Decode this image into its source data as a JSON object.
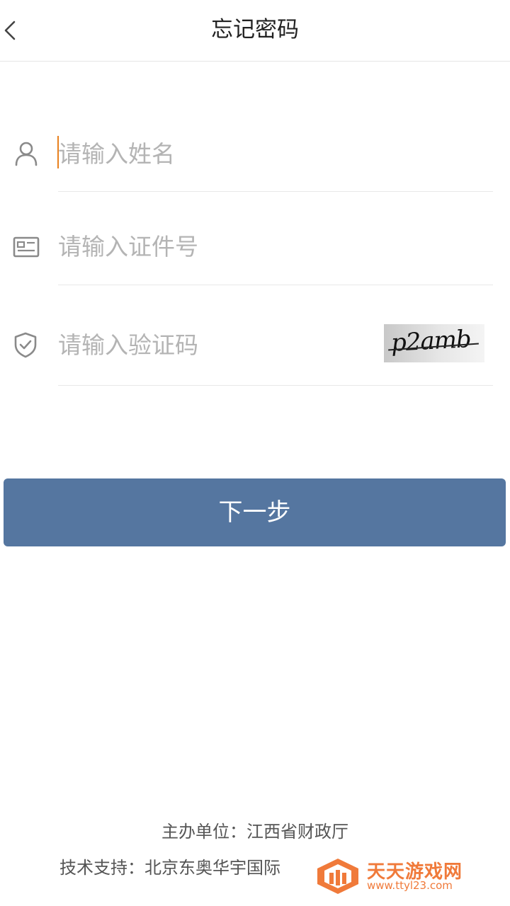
{
  "header": {
    "title": "忘记密码"
  },
  "form": {
    "name_placeholder": "请输入姓名",
    "id_placeholder": "请输入证件号",
    "captcha_placeholder": "请输入验证码",
    "captcha_text": "p2amb"
  },
  "actions": {
    "next_label": "下一步"
  },
  "footer": {
    "organizer": "主办单位：江西省财政厅",
    "tech_support": "技术支持：北京东奥华宇国际"
  },
  "watermark": {
    "name": "天天游戏网",
    "url": "www.ttyl23.com"
  },
  "colors": {
    "primary_button": "#5576a0",
    "cursor": "#e8801e",
    "watermark": "#f07a3a"
  },
  "icons": {
    "back": "chevron-left-icon",
    "name": "user-icon",
    "id": "id-card-icon",
    "captcha": "shield-check-icon"
  }
}
